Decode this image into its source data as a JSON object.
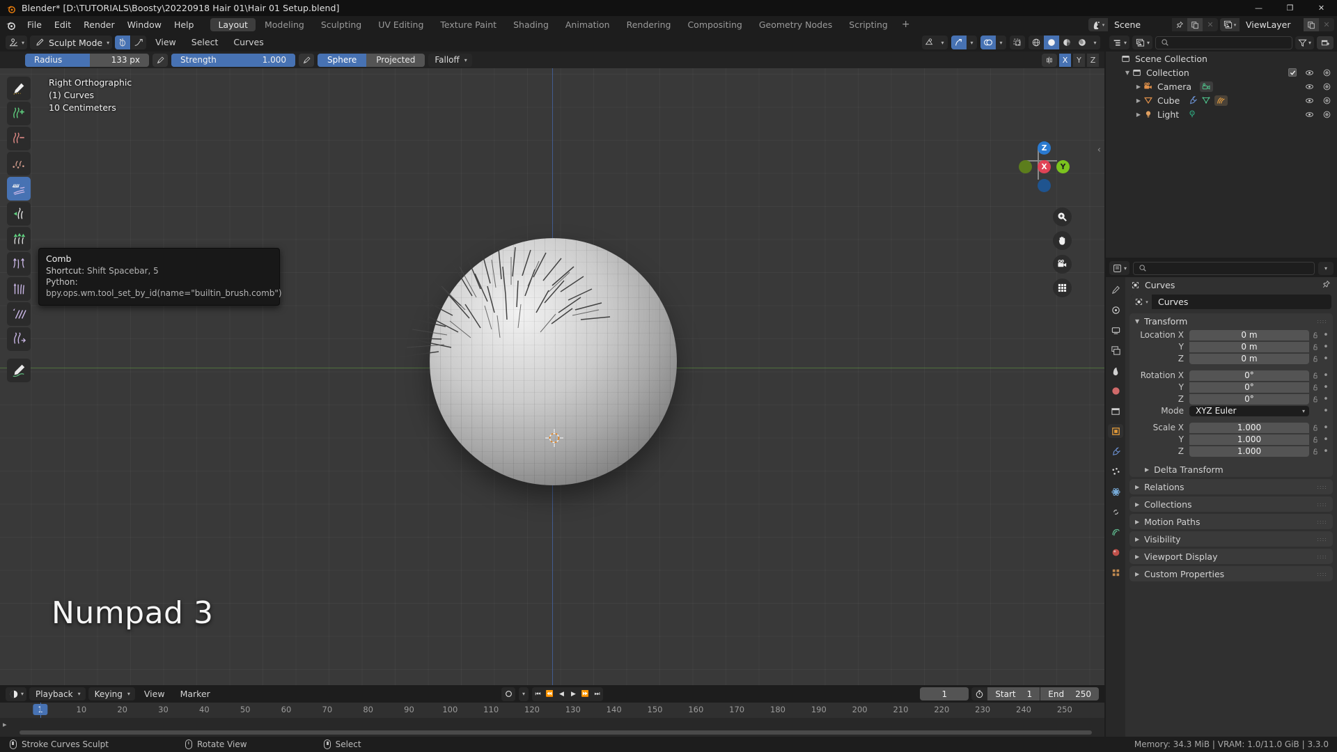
{
  "window": {
    "title": "Blender* [D:\\TUTORIALS\\Boosty\\20220918 Hair 01\\Hair 01 Setup.blend]",
    "minimize": "—",
    "maximize": "❐",
    "close": "✕"
  },
  "topbar": {
    "menus": [
      "File",
      "Edit",
      "Render",
      "Window",
      "Help"
    ],
    "workspaces": [
      "Layout",
      "Modeling",
      "Sculpting",
      "UV Editing",
      "Texture Paint",
      "Shading",
      "Animation",
      "Rendering",
      "Compositing",
      "Geometry Nodes",
      "Scripting"
    ],
    "active_workspace": "Layout",
    "add_workspace": "+",
    "scene": {
      "label": "Scene",
      "icon": "scene-icon",
      "pin": "pin-icon",
      "copy": "new-scene-icon",
      "unlink": "✕"
    },
    "viewlayer": {
      "label": "ViewLayer",
      "icon": "viewlayer-icon",
      "copy": "new-viewlayer-icon",
      "unlink": "✕"
    }
  },
  "viewport_header": {
    "editor_type": "3d-viewport-icon",
    "mode": "Sculpt Mode",
    "menus": [
      "View",
      "Select",
      "Curves"
    ],
    "gizmo_label": "show-gizmo-icon",
    "overlay_label": "show-overlays-icon",
    "shading_modes": [
      "Wireframe",
      "Solid",
      "Material Preview",
      "Rendered"
    ],
    "active_shading": "Solid"
  },
  "tool_settings": {
    "radius": {
      "label": "Radius",
      "value": "133 px",
      "fill_percent": 52
    },
    "strength": {
      "label": "Strength",
      "value": "1.000",
      "fill_percent": 100
    },
    "falloff_shapes": [
      "Sphere",
      "Projected"
    ],
    "active_falloff_shape": "Sphere",
    "falloff": "Falloff",
    "symmetry_axes": [
      "X",
      "Y",
      "Z"
    ],
    "active_symmetry": "X"
  },
  "viewport": {
    "info_lines": [
      "Right Orthographic",
      "(1) Curves",
      "10 Centimeters"
    ],
    "overlay_text": "Numpad 3",
    "gizmo": {
      "x": {
        "label": "X",
        "color": "#e04356"
      },
      "y": {
        "label": "Y",
        "color": "#7bc31e"
      },
      "z": {
        "label": "Z",
        "color": "#2a7ad0"
      }
    },
    "nav_buttons": [
      "zoom-icon",
      "pan-hand-icon",
      "camera-view-icon",
      "toggle-ortho-icon"
    ],
    "collapse": "‹"
  },
  "tools": [
    {
      "name": "draw-brush",
      "active": false
    },
    {
      "name": "add-curves-brush",
      "active": false
    },
    {
      "name": "delete-curves-brush",
      "active": false
    },
    {
      "name": "density-brush",
      "active": false
    },
    {
      "name": "comb-brush",
      "active": true
    },
    {
      "name": "snake-hook-brush",
      "active": false
    },
    {
      "name": "grow-shrink-brush",
      "active": false
    },
    {
      "name": "pinch-brush",
      "active": false
    },
    {
      "name": "puff-brush",
      "active": false
    },
    {
      "name": "slide-brush",
      "active": false
    },
    {
      "name": "smooth-brush",
      "active": false
    },
    {
      "name": "annotate-tool",
      "active": false
    }
  ],
  "tooltip": {
    "title": "Comb",
    "shortcut_key": "Shortcut:",
    "shortcut_value": "Shift Spacebar, 5",
    "python_key": "Python:",
    "python_value": "bpy.ops.wm.tool_set_by_id(name=\"builtin_brush.comb\")"
  },
  "outliner": {
    "display_mode": "view-layer-icon",
    "search_placeholder": "",
    "filter": "filter-icon",
    "new_collection": "new-collection-icon",
    "rows": [
      {
        "label": "Scene Collection",
        "icon": "collection-icon",
        "indent": 0,
        "disclosure": "",
        "has_checkbox": false,
        "has_visibility": false,
        "extra_icons": []
      },
      {
        "label": "Collection",
        "icon": "collection-icon",
        "indent": 1,
        "disclosure": "▼",
        "has_checkbox": true,
        "has_visibility": true,
        "extra_icons": []
      },
      {
        "label": "Camera",
        "icon": "camera-icon",
        "indent": 2,
        "disclosure": "▶",
        "has_checkbox": false,
        "has_visibility": true,
        "extra_icons": [
          "camera-data-icon"
        ]
      },
      {
        "label": "Cube",
        "icon": "mesh-icon",
        "indent": 2,
        "disclosure": "▶",
        "has_checkbox": false,
        "has_visibility": true,
        "extra_icons": [
          "modifier-wrench-icon",
          "mesh-data-icon",
          "curves-data-icon"
        ]
      },
      {
        "label": "Light",
        "icon": "light-icon",
        "indent": 2,
        "disclosure": "▶",
        "has_checkbox": false,
        "has_visibility": true,
        "extra_icons": [
          "light-data-icon"
        ]
      }
    ]
  },
  "properties": {
    "search_placeholder": "",
    "breadcrumb": "Curves",
    "object_name": "Curves",
    "tabs": [
      "tool-icon",
      "render-icon",
      "output-icon",
      "view-layer-icon",
      "scene-icon",
      "world-icon",
      "collection-properties-icon",
      "object-icon",
      "modifier-icon",
      "particles-icon",
      "physics-icon",
      "constraints-icon",
      "data-icon",
      "material-icon",
      "texture-icon"
    ],
    "active_tab_index": 7,
    "transform": {
      "title": "Transform",
      "location": {
        "label": "Location",
        "axes": [
          "X",
          "Y",
          "Z"
        ],
        "values": [
          "0 m",
          "0 m",
          "0 m"
        ]
      },
      "rotation": {
        "label": "Rotation",
        "axes": [
          "X",
          "Y",
          "Z"
        ],
        "values": [
          "0°",
          "0°",
          "0°"
        ]
      },
      "mode": {
        "label": "Mode",
        "value": "XYZ Euler"
      },
      "scale": {
        "label": "Scale",
        "axes": [
          "X",
          "Y",
          "Z"
        ],
        "values": [
          "1.000",
          "1.000",
          "1.000"
        ]
      },
      "delta_transform": "Delta Transform"
    },
    "collapsed_panels": [
      "Relations",
      "Collections",
      "Motion Paths",
      "Visibility",
      "Viewport Display",
      "Custom Properties"
    ]
  },
  "timeline": {
    "editor_icon": "timeline-icon",
    "menus": [
      "Playback",
      "Keying",
      "View",
      "Marker"
    ],
    "transport": [
      "⏮",
      "⏪",
      "◀",
      "▶",
      "⏩",
      "⏭"
    ],
    "auto_key": "record-icon",
    "current_frame": "1",
    "start": {
      "label": "Start",
      "value": "1"
    },
    "end": {
      "label": "End",
      "value": "250"
    },
    "ticks": [
      10,
      20,
      30,
      40,
      50,
      60,
      70,
      80,
      90,
      100,
      110,
      120,
      130,
      140,
      150,
      160,
      170,
      180,
      190,
      200,
      210,
      220,
      230,
      240,
      250
    ],
    "playhead_frame": "1"
  },
  "statusbar": {
    "items": [
      {
        "icon": "mouse-left-icon",
        "label": "Stroke Curves Sculpt"
      },
      {
        "icon": "mouse-middle-icon",
        "label": "Rotate View"
      },
      {
        "icon": "mouse-right-icon",
        "label": "Select"
      }
    ],
    "info": "Memory: 34.3 MiB | VRAM: 1.0/11.0 GiB | 3.3.0"
  },
  "colors": {
    "accent_blue": "#4772b3",
    "header_dark": "#1d1d1d",
    "panel": "#303030",
    "viewport_bg": "#393939",
    "orange": "#e87d0d"
  }
}
